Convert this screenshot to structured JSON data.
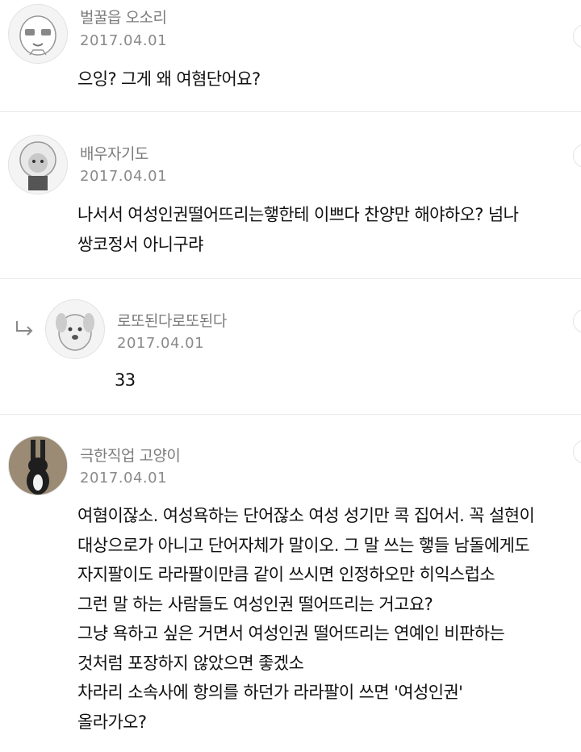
{
  "comments": [
    {
      "username": "벌꿀읍 오소리",
      "date": "2017.04.01",
      "lines": [
        "으잉? 그게 왜 여혐단어요?"
      ]
    },
    {
      "username": "배우자기도",
      "date": "2017.04.01",
      "lines": [
        "나서서 여성인권떨어뜨리는햏한테 이쁘다 찬양만 해야하오? 넘나",
        "쌍코정서 아니구랴"
      ]
    },
    {
      "username": "로또된다로또된다",
      "date": "2017.04.01",
      "lines": [
        "33"
      ]
    },
    {
      "username": "극한직업 고양이",
      "date": "2017.04.01",
      "lines": [
        "여혐이잖소. 여성욕하는 단어잖소 여성 성기만 콕 집어서. 꼭 설현이",
        "대상으로가 아니고 단어자체가 말이오. 그 말 쓰는 햏들 남돌에게도",
        "자지팔이도 라라팔이만큼 같이 쓰시면 인정하오만 히익스럽소",
        "그런 말 하는 사람들도 여성인권 떨어뜨리는 거고요?",
        "그냥 욕하고 싶은 거면서 여성인권 떨어뜨리는 연예인 비판하는",
        "것처럼 포장하지 않았으면 좋겠소",
        "차라리 소속사에 항의를 하던가 라라팔이 쓰면 '여성인권'",
        "올라가오?"
      ]
    }
  ]
}
